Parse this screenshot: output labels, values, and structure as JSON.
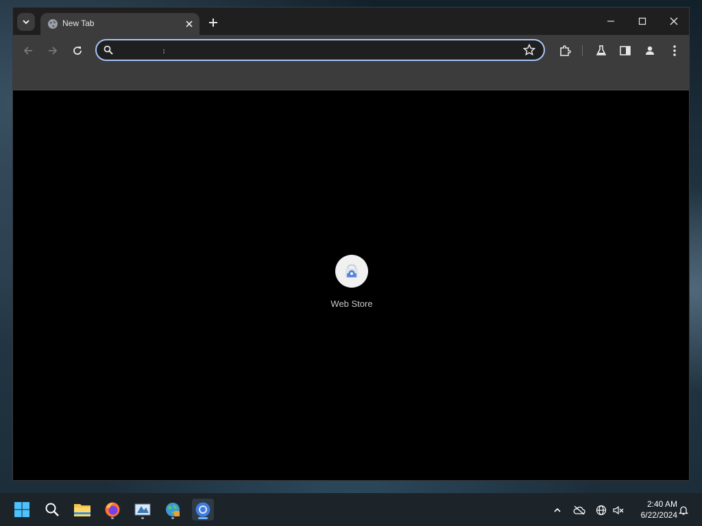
{
  "browser": {
    "tab": {
      "title": "New Tab"
    },
    "omnibox": {
      "value": "",
      "placeholder": ""
    },
    "shortcuts": [
      {
        "label": "Web Store"
      }
    ]
  },
  "taskbar": {
    "apps": [
      "start",
      "search",
      "file-explorer",
      "firefox",
      "vlc",
      "paint-app",
      "chrome"
    ],
    "active_app": "chrome",
    "clock": {
      "time": "2:40 AM",
      "date": "6/22/2024"
    }
  },
  "colors": {
    "omnibox_focus": "#a8c7fa",
    "tab_active": "#3c3c3c",
    "tabstrip": "#1f1f1f",
    "content_bg": "#000000"
  }
}
